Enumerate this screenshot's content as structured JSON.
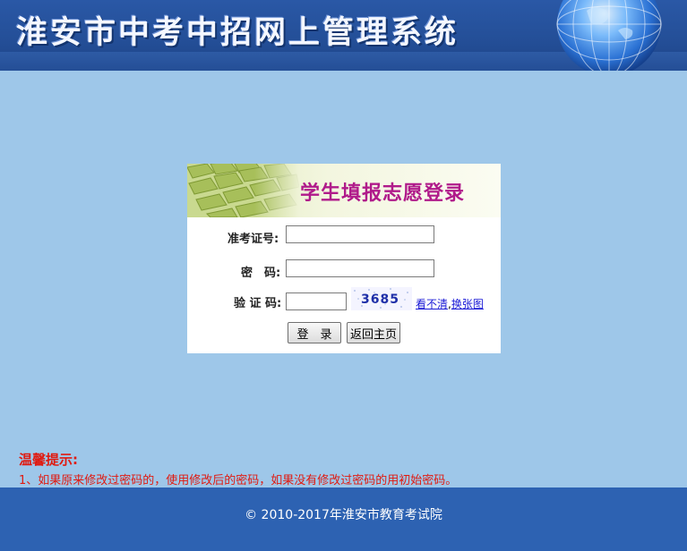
{
  "header": {
    "system_title": "淮安市中考中招网上管理系统",
    "globe_icon": "globe-icon"
  },
  "login": {
    "title": "学生填报志愿登录",
    "exam_id_label": "准考证号:",
    "password_label": "密　码:",
    "captcha_label": "验 证 码:",
    "exam_id_value": "",
    "password_value": "",
    "captcha_value": "",
    "captcha_code": "3685",
    "captcha_unclear": "看不清",
    "captcha_separator": ",",
    "captcha_refresh": "换张图",
    "login_button": "登　录",
    "back_button": "返回主页"
  },
  "notice": {
    "title": "温馨提示:",
    "item_1": "1、如果原来修改过密码的，使用修改后的密码，如果没有修改过密码的用初始密码。"
  },
  "footer": {
    "copyright": "© 2010-2017年淮安市教育考试院"
  },
  "colors": {
    "page_background": "#9ec7e9",
    "header_blue": "#244f98",
    "footer_blue": "#2d62b2",
    "title_magenta": "#b01a8a",
    "notice_red": "#e01a10",
    "link_blue": "#1a1ad6"
  }
}
